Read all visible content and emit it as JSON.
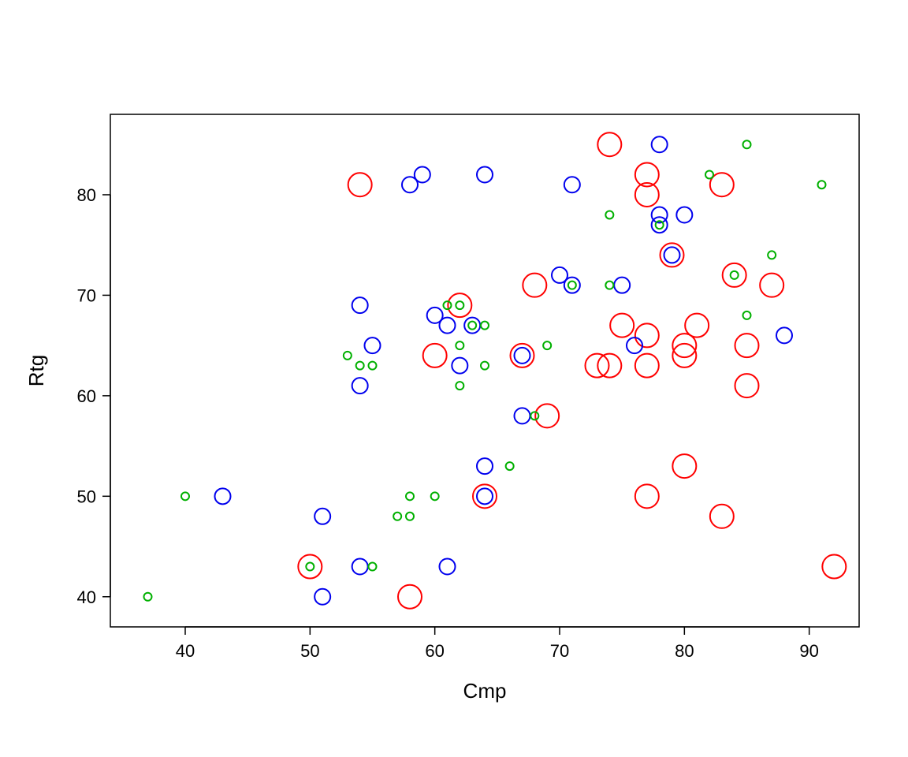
{
  "chart_data": {
    "type": "scatter",
    "xlabel": "Cmp",
    "ylabel": "Rtg",
    "xlim": [
      34,
      94
    ],
    "ylim": [
      37,
      88
    ],
    "xticks": [
      40,
      50,
      60,
      70,
      80,
      90
    ],
    "yticks": [
      40,
      50,
      60,
      70,
      80
    ],
    "series": [
      {
        "name": "red",
        "color": "#ff0000",
        "radius": 15,
        "points": [
          {
            "x": 54,
            "y": 81
          },
          {
            "x": 62,
            "y": 69
          },
          {
            "x": 68,
            "y": 71
          },
          {
            "x": 74,
            "y": 85
          },
          {
            "x": 77,
            "y": 80
          },
          {
            "x": 77,
            "y": 82
          },
          {
            "x": 83,
            "y": 81
          },
          {
            "x": 84,
            "y": 72
          },
          {
            "x": 87,
            "y": 71
          },
          {
            "x": 85,
            "y": 65
          },
          {
            "x": 80,
            "y": 64
          },
          {
            "x": 80,
            "y": 65
          },
          {
            "x": 81,
            "y": 67
          },
          {
            "x": 77,
            "y": 66
          },
          {
            "x": 77,
            "y": 63
          },
          {
            "x": 79,
            "y": 74
          },
          {
            "x": 75,
            "y": 67
          },
          {
            "x": 74,
            "y": 63
          },
          {
            "x": 73,
            "y": 63
          },
          {
            "x": 67,
            "y": 64
          },
          {
            "x": 69,
            "y": 58
          },
          {
            "x": 85,
            "y": 61
          },
          {
            "x": 83,
            "y": 48
          },
          {
            "x": 80,
            "y": 53
          },
          {
            "x": 77,
            "y": 50
          },
          {
            "x": 60,
            "y": 64
          },
          {
            "x": 64,
            "y": 50
          },
          {
            "x": 58,
            "y": 40
          },
          {
            "x": 50,
            "y": 43
          },
          {
            "x": 92,
            "y": 43
          }
        ]
      },
      {
        "name": "blue",
        "color": "#0000ee",
        "radius": 10,
        "points": [
          {
            "x": 43,
            "y": 50
          },
          {
            "x": 51,
            "y": 48
          },
          {
            "x": 51,
            "y": 40
          },
          {
            "x": 54,
            "y": 43
          },
          {
            "x": 54,
            "y": 61
          },
          {
            "x": 55,
            "y": 65
          },
          {
            "x": 54,
            "y": 69
          },
          {
            "x": 58,
            "y": 81
          },
          {
            "x": 59,
            "y": 82
          },
          {
            "x": 64,
            "y": 82
          },
          {
            "x": 60,
            "y": 68
          },
          {
            "x": 61,
            "y": 67
          },
          {
            "x": 63,
            "y": 67
          },
          {
            "x": 62,
            "y": 63
          },
          {
            "x": 61,
            "y": 43
          },
          {
            "x": 64,
            "y": 50
          },
          {
            "x": 64,
            "y": 53
          },
          {
            "x": 67,
            "y": 58
          },
          {
            "x": 67,
            "y": 64
          },
          {
            "x": 70,
            "y": 72
          },
          {
            "x": 71,
            "y": 71
          },
          {
            "x": 71,
            "y": 81
          },
          {
            "x": 75,
            "y": 71
          },
          {
            "x": 76,
            "y": 65
          },
          {
            "x": 78,
            "y": 78
          },
          {
            "x": 78,
            "y": 85
          },
          {
            "x": 78,
            "y": 77
          },
          {
            "x": 80,
            "y": 78
          },
          {
            "x": 79,
            "y": 74
          },
          {
            "x": 88,
            "y": 66
          }
        ]
      },
      {
        "name": "green",
        "color": "#00b000",
        "radius": 5,
        "points": [
          {
            "x": 37,
            "y": 40
          },
          {
            "x": 40,
            "y": 50
          },
          {
            "x": 50,
            "y": 43
          },
          {
            "x": 54,
            "y": 63
          },
          {
            "x": 55,
            "y": 63
          },
          {
            "x": 53,
            "y": 64
          },
          {
            "x": 55,
            "y": 43
          },
          {
            "x": 57,
            "y": 48
          },
          {
            "x": 58,
            "y": 48
          },
          {
            "x": 58,
            "y": 50
          },
          {
            "x": 60,
            "y": 50
          },
          {
            "x": 62,
            "y": 65
          },
          {
            "x": 63,
            "y": 67
          },
          {
            "x": 61,
            "y": 69
          },
          {
            "x": 62,
            "y": 69
          },
          {
            "x": 62,
            "y": 61
          },
          {
            "x": 64,
            "y": 63
          },
          {
            "x": 64,
            "y": 67
          },
          {
            "x": 66,
            "y": 53
          },
          {
            "x": 68,
            "y": 58
          },
          {
            "x": 69,
            "y": 65
          },
          {
            "x": 71,
            "y": 71
          },
          {
            "x": 74,
            "y": 71
          },
          {
            "x": 74,
            "y": 78
          },
          {
            "x": 78,
            "y": 77
          },
          {
            "x": 82,
            "y": 82
          },
          {
            "x": 84,
            "y": 72
          },
          {
            "x": 85,
            "y": 68
          },
          {
            "x": 85,
            "y": 85
          },
          {
            "x": 87,
            "y": 74
          },
          {
            "x": 91,
            "y": 81
          }
        ]
      }
    ]
  }
}
